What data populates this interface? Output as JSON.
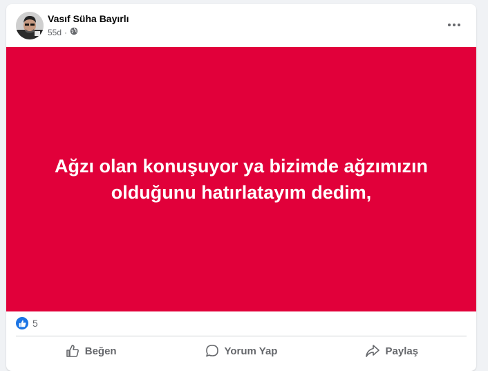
{
  "post": {
    "author": "Vasıf Süha Bayırlı",
    "time": "55d",
    "visibility_icon": "globe-icon",
    "text_line1": "Ağzı olan konuşuyor ya bizimde ağzımızın",
    "text_line2": "olduğunu hatırlatayım dedim,",
    "background_color": "#e1003a",
    "reaction_count": "5",
    "reaction_icon": "like-icon"
  },
  "actions": {
    "like_label": "Beğen",
    "comment_label": "Yorum Yap",
    "share_label": "Paylaş"
  },
  "colors": {
    "like_blue": "#1b74e4",
    "text_secondary": "#65676b"
  }
}
